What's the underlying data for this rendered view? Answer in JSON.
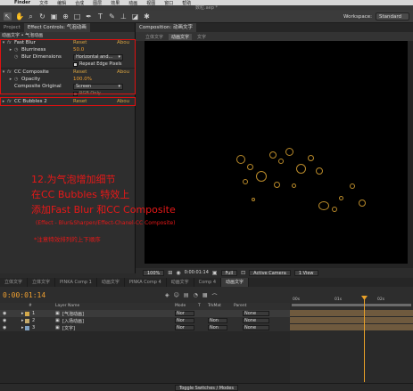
{
  "menubar": {
    "app": "Finder",
    "items": [
      "文件",
      "编辑",
      "合成",
      "图层",
      "效果",
      "动画",
      "视图",
      "窗口",
      "帮助"
    ]
  },
  "window_title": "数粒.aep *",
  "workspace": {
    "label": "Workspace:",
    "value": "Standard"
  },
  "left_panel": {
    "tabs": [
      "Project",
      "Effect Controls: 气泡动画"
    ],
    "breadcrumb": "动画文字 • 气泡动画",
    "effects": [
      {
        "name": "Fast Blur",
        "reset": "Reset",
        "about": "Abou"
      },
      {
        "name": "Blurriness",
        "value": "50.0"
      },
      {
        "name": "Blur Dimensions",
        "value": "Horizontal and..."
      },
      {
        "name": "Repeat Edge Pixels",
        "checked": true
      },
      {
        "name": "CC Composite",
        "reset": "Reset",
        "about": "Abou"
      },
      {
        "name": "Opacity",
        "value": "100.0%"
      },
      {
        "name": "Composite Original",
        "value": "Screen"
      },
      {
        "name": "RGB Only",
        "checked": false
      },
      {
        "name": "CC Bubbles 2",
        "reset": "Reset",
        "about": "Abou"
      }
    ]
  },
  "comp_panel": {
    "tab": "Composition: 动画文字",
    "subtabs": [
      "立体文字",
      "动画文字",
      "文字"
    ],
    "viewbar": {
      "zoom": "100%",
      "timecode": "0:00:01:14",
      "resolution": "Full",
      "camera": "Active Camera",
      "views": "1 View"
    }
  },
  "timeline": {
    "tabs": [
      "立体文字",
      "立体文字",
      "PINKA Comp 1",
      "动画文字",
      "PINKA Comp 4",
      "动画文字",
      "Comp 4",
      "动画文字"
    ],
    "timecode": "0:00:01:14",
    "columns": {
      "num": "#",
      "name": "Layer Name",
      "mode": "Mode",
      "t": "T",
      "trkmat": "TrkMat",
      "parent": "Parent"
    },
    "ruler": [
      "00s",
      "01s",
      "02s"
    ],
    "layers": [
      {
        "num": "1",
        "name": "[气泡动画]",
        "mode": "Nor",
        "trkmat": "",
        "parent": "None",
        "label": "#d4a94a"
      },
      {
        "num": "2",
        "name": "[入场动画]",
        "mode": "Nor",
        "trkmat": "Non",
        "parent": "None",
        "label": "#c4a96a"
      },
      {
        "num": "3",
        "name": "[文字]",
        "mode": "Nor",
        "trkmat": "Non",
        "parent": "None",
        "label": "#7fa0c0"
      }
    ],
    "footer_toggle": "Toggle Switches / Modes"
  },
  "annotation": {
    "lines": [
      "12.为气泡增加细节",
      "在CC Bubbles 特效上",
      "添加Fast Blur 和CC Composite"
    ],
    "path": "(Effect - Blur&Sharpen/Effect-Chanel-CC Composite)",
    "note": "*注意特效排列的上下顺序"
  }
}
